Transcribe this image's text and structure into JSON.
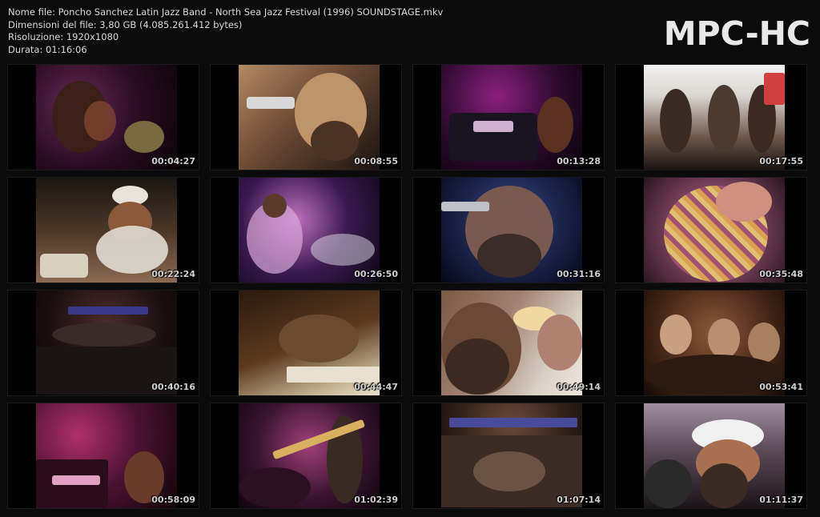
{
  "info": {
    "filename": "Nome file: Poncho Sanchez Latin Jazz Band - North Sea Jazz Festival (1996) SOUNDSTAGE.mkv",
    "filesize": "Dimensioni del file: 3,80 GB (4.085.261.412 bytes)",
    "resolution": "Risoluzione: 1920x1080",
    "duration": "Durata: 01:16:06"
  },
  "logo": "MPC-HC",
  "thumbnails": [
    {
      "time": "00:04:27"
    },
    {
      "time": "00:08:55"
    },
    {
      "time": "00:13:28"
    },
    {
      "time": "00:17:55"
    },
    {
      "time": "00:22:24"
    },
    {
      "time": "00:26:50"
    },
    {
      "time": "00:31:16"
    },
    {
      "time": "00:35:48"
    },
    {
      "time": "00:40:16"
    },
    {
      "time": "00:44:47"
    },
    {
      "time": "00:49:14"
    },
    {
      "time": "00:53:41"
    },
    {
      "time": "00:58:09"
    },
    {
      "time": "01:02:39"
    },
    {
      "time": "01:07:14"
    },
    {
      "time": "01:11:37"
    }
  ]
}
